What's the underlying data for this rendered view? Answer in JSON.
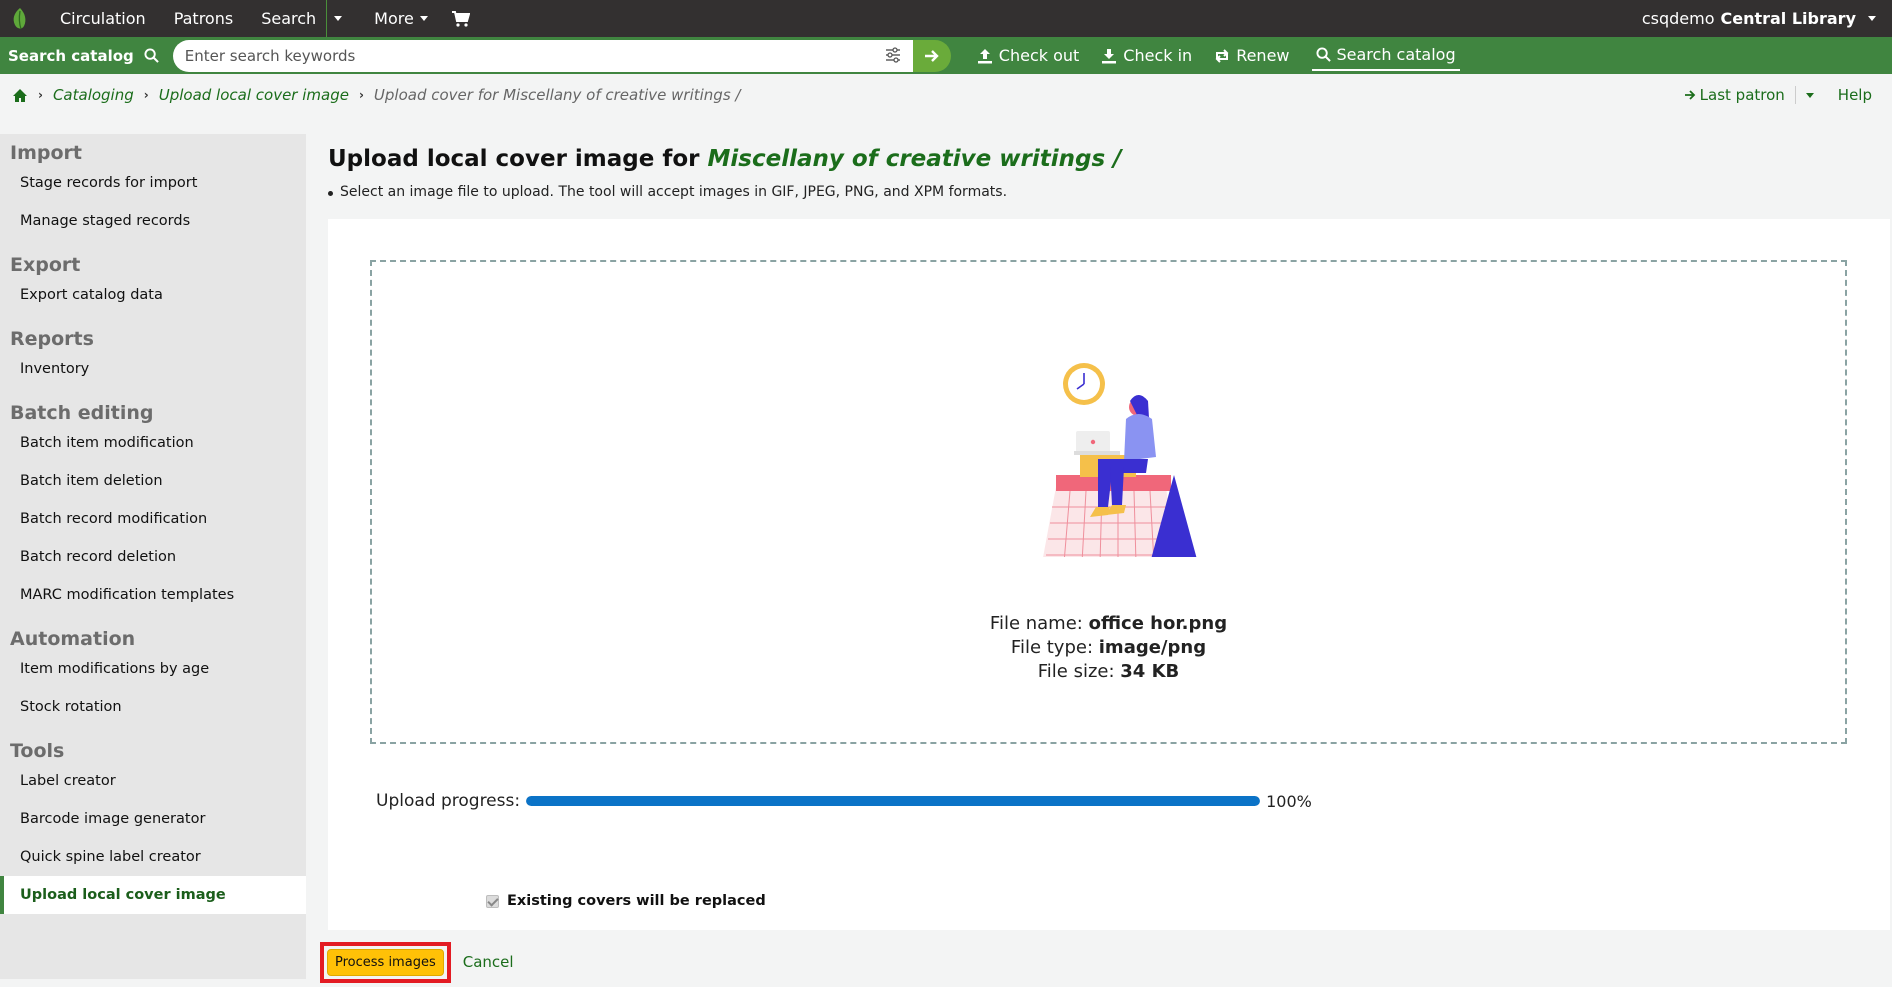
{
  "topnav": {
    "items": [
      "Circulation",
      "Patrons",
      "Search",
      "More"
    ],
    "user": "csqdemo",
    "library": "Central Library"
  },
  "searchbar": {
    "label": "Search catalog",
    "placeholder": "Enter search keywords",
    "links": [
      "Check out",
      "Check in",
      "Renew",
      "Search catalog"
    ]
  },
  "breadcrumb": {
    "items": [
      "Cataloging",
      "Upload local cover image"
    ],
    "current": "Upload cover for Miscellany of creative writings /",
    "last_patron": "Last patron",
    "help": "Help"
  },
  "sidebar": {
    "sections": [
      {
        "heading": "Import",
        "items": [
          "Stage records for import",
          "Manage staged records"
        ]
      },
      {
        "heading": "Export",
        "items": [
          "Export catalog data"
        ]
      },
      {
        "heading": "Reports",
        "items": [
          "Inventory"
        ]
      },
      {
        "heading": "Batch editing",
        "items": [
          "Batch item modification",
          "Batch item deletion",
          "Batch record modification",
          "Batch record deletion",
          "MARC modification templates"
        ]
      },
      {
        "heading": "Automation",
        "items": [
          "Item modifications by age",
          "Stock rotation"
        ]
      },
      {
        "heading": "Tools",
        "items": [
          "Label creator",
          "Barcode image generator",
          "Quick spine label creator",
          "Upload local cover image"
        ]
      }
    ]
  },
  "main": {
    "title_prefix": "Upload local cover image for ",
    "book_title": "Miscellany of creative writings /",
    "hint": "Select an image file to upload. The tool will accept images in GIF, JPEG, PNG, and XPM formats."
  },
  "file": {
    "name_label": "File name:",
    "name": "office hor.png",
    "type_label": "File type:",
    "type": "image/png",
    "size_label": "File size:",
    "size": "34 KB"
  },
  "upload": {
    "label": "Upload progress:",
    "percent": 100,
    "percent_text": "100%"
  },
  "replace_label": "Existing covers will be replaced",
  "actions": {
    "process": "Process images",
    "cancel": "Cancel"
  },
  "colors": {
    "topbar": "#333030",
    "brand_green": "#408540",
    "link_green": "#1b6d1b",
    "progress": "#0b73c7",
    "highlight": "#e31b23"
  }
}
